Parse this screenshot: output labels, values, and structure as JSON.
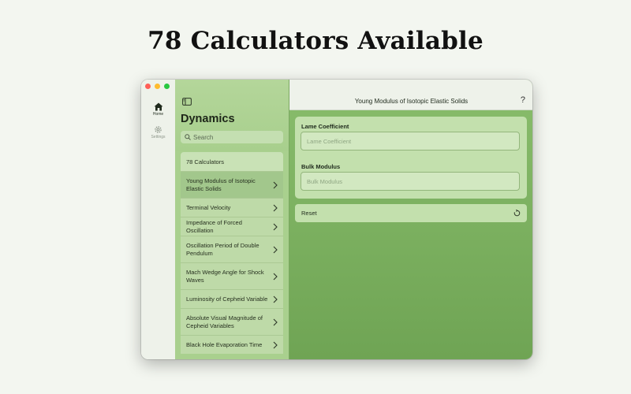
{
  "headline": "78 Calculators Available",
  "rail": {
    "home_label": "Home",
    "settings_label": "Settings"
  },
  "list": {
    "title": "Dynamics",
    "search_placeholder": "Search",
    "count_label": "78 Calculators",
    "items": [
      {
        "label": "Young Modulus of Isotopic Elastic Solids",
        "selected": true
      },
      {
        "label": "Terminal Velocity"
      },
      {
        "label": "Impedance of Forced Oscillation"
      },
      {
        "label": "Oscillation Period of Double Pendulum"
      },
      {
        "label": "Mach Wedge Angle for Shock Waves"
      },
      {
        "label": "Luminosity of Cepheid Variable"
      },
      {
        "label": "Absolute Visual Magnitude of Cepheid Variables"
      },
      {
        "label": "Black Hole Evaporation Time"
      }
    ]
  },
  "detail": {
    "title": "Young Modulus of Isotopic Elastic Solids",
    "help_label": "?",
    "fields": [
      {
        "label": "Lame Coefficient",
        "placeholder": "Lame Coefficient",
        "value": ""
      },
      {
        "label": "Bulk Modulus",
        "placeholder": "Bulk Modulus",
        "value": ""
      }
    ],
    "reset_label": "Reset"
  },
  "colors": {
    "accent_green": "#89bd6c",
    "list_green": "#a9d08e",
    "selected_row": "#a2c78c"
  },
  "icons": [
    "house-icon",
    "gear-icon",
    "sidebar-toggle-icon",
    "search-icon",
    "chevron-right-icon",
    "reset-icon"
  ]
}
